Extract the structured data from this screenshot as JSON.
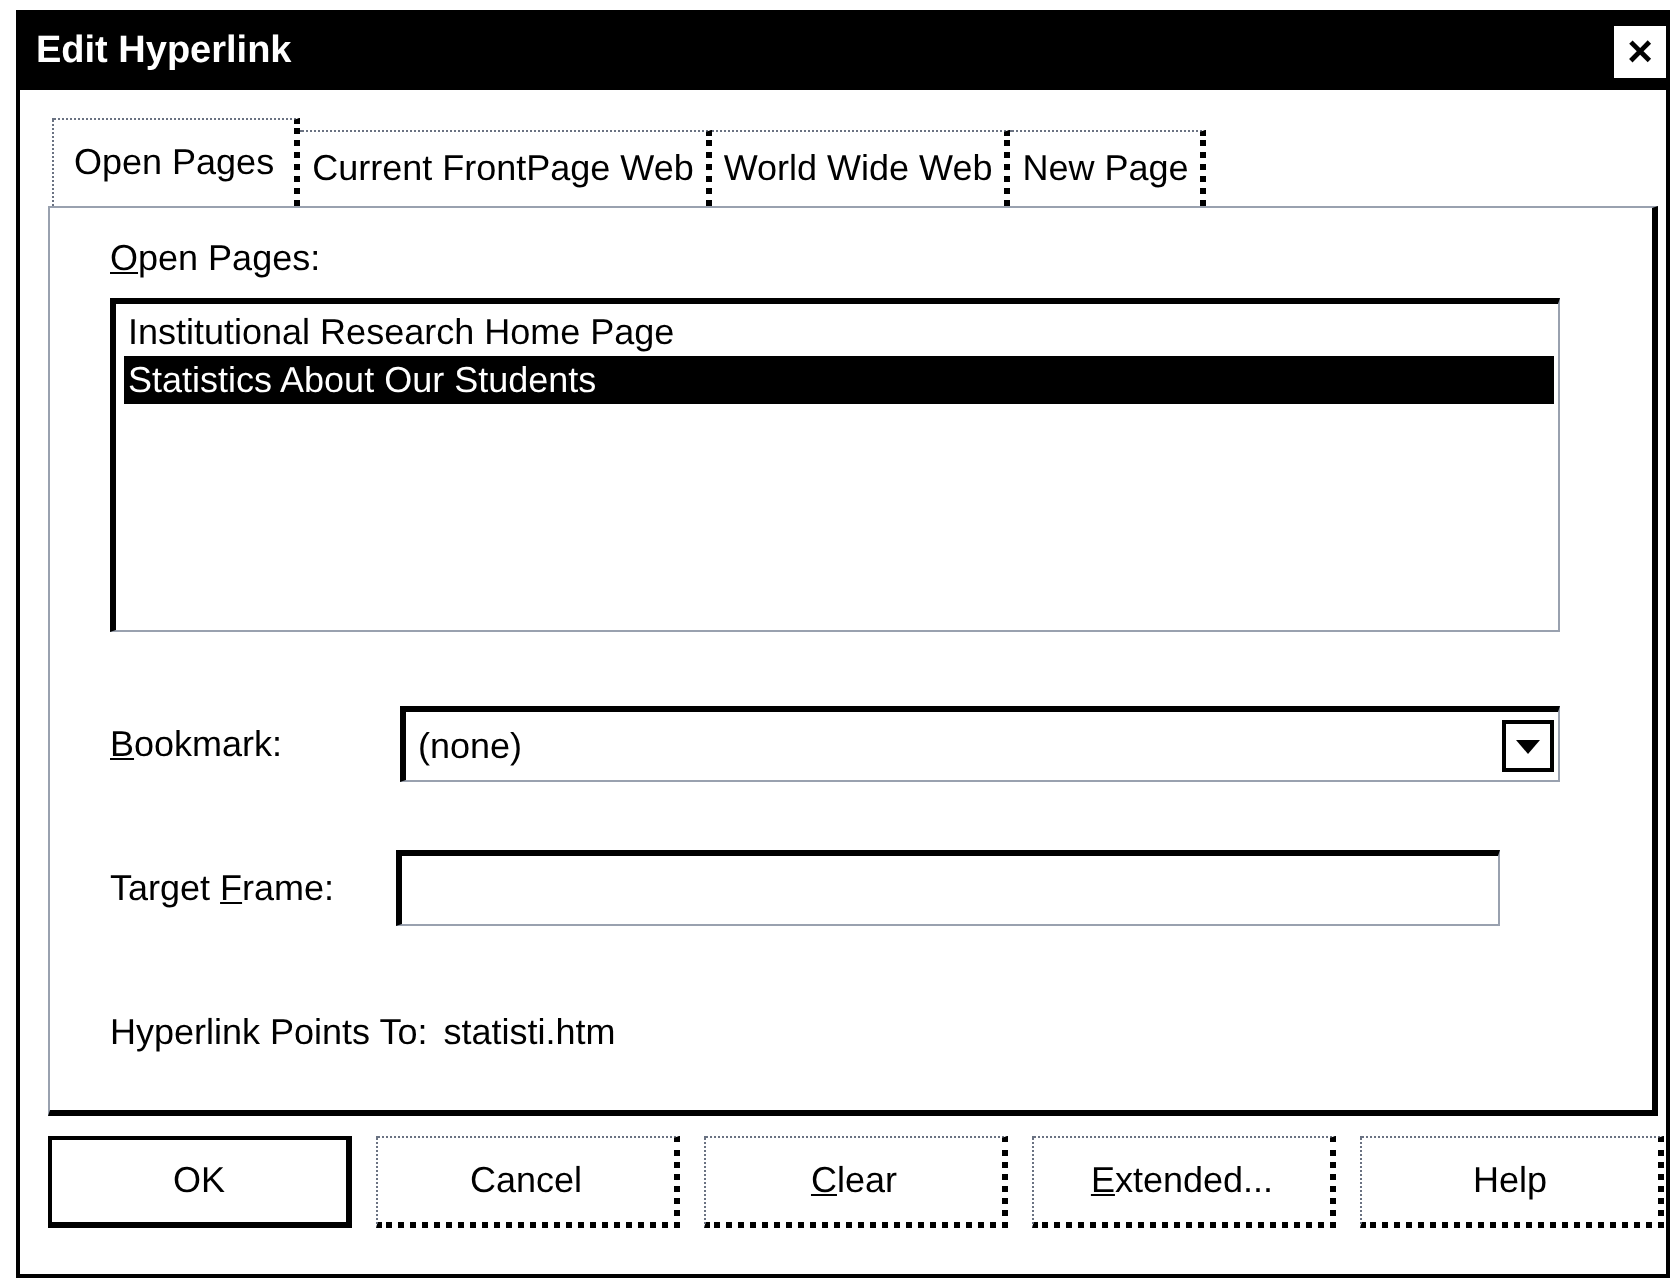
{
  "window": {
    "title": "Edit Hyperlink",
    "close": "×"
  },
  "tabs": [
    {
      "label": "Open Pages",
      "selected": true
    },
    {
      "label": "Current FrontPage Web",
      "selected": false
    },
    {
      "label": "World Wide Web",
      "selected": false
    },
    {
      "label": "New Page",
      "selected": false
    }
  ],
  "open_pages": {
    "label": {
      "key": "O",
      "after": "pen Pages:"
    },
    "items": [
      {
        "label": "Institutional Research Home Page",
        "selected": false
      },
      {
        "label": "Statistics About Our Students",
        "selected": true
      }
    ]
  },
  "bookmark": {
    "label": {
      "key": "B",
      "after": "ookmark:"
    },
    "value": "(none)"
  },
  "target_frame": {
    "label": {
      "before": "Target ",
      "key": "F",
      "after": "rame:"
    }
  },
  "points_to": {
    "label": "Hyperlink Points To:",
    "value": "statisti.htm"
  },
  "buttons": [
    {
      "after": "OK",
      "default": true
    },
    {
      "after": "Cancel",
      "default": false
    },
    {
      "key": "C",
      "after": "lear",
      "default": false
    },
    {
      "key": "E",
      "after": "xtended...",
      "default": false
    },
    {
      "after": "Help",
      "default": false
    }
  ]
}
